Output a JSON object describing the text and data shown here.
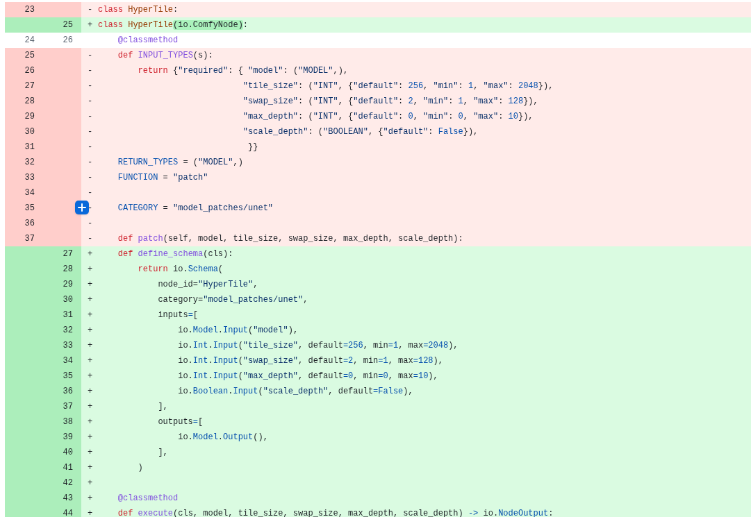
{
  "diff": {
    "rows": [
      {
        "kind": "del",
        "old": "23",
        "sign": "-",
        "code": [
          {
            "kind": "keyword",
            "text": "class"
          },
          {
            "kind": "class",
            "text": " HyperTile"
          },
          {
            "kind": "plain",
            "text": ":"
          }
        ]
      },
      {
        "kind": "add",
        "new": "25",
        "sign": "+",
        "code": [
          {
            "kind": "keyword",
            "text": "class"
          },
          {
            "kind": "class",
            "text": " HyperTile"
          },
          {
            "kind": "plain",
            "text": "(io.ComfyNode)",
            "highlighted": true
          },
          {
            "kind": "plain",
            "text": ":"
          }
        ]
      },
      {
        "kind": "ctx",
        "old": "24",
        "new": "26",
        "code": [
          {
            "kind": "function",
            "text": "    @classmethod"
          }
        ]
      },
      {
        "kind": "del",
        "old": "25",
        "sign": "-",
        "code": [
          {
            "kind": "keyword",
            "text": "    def"
          },
          {
            "kind": "function",
            "text": " INPUT_TYPES"
          },
          {
            "kind": "plain",
            "text": "(s):"
          }
        ]
      },
      {
        "kind": "del",
        "old": "26",
        "sign": "-",
        "code": [
          {
            "kind": "keyword",
            "text": "        return"
          },
          {
            "kind": "plain",
            "text": " {"
          },
          {
            "kind": "string",
            "text": "\"required\""
          },
          {
            "kind": "plain",
            "text": ": { "
          },
          {
            "kind": "string",
            "text": "\"model\""
          },
          {
            "kind": "plain",
            "text": ": ("
          },
          {
            "kind": "string",
            "text": "\"MODEL\""
          },
          {
            "kind": "plain",
            "text": ",),"
          }
        ]
      },
      {
        "kind": "del",
        "old": "27",
        "sign": "-",
        "code": [
          {
            "kind": "string",
            "text": "                             \"tile_size\""
          },
          {
            "kind": "plain",
            "text": ": ("
          },
          {
            "kind": "string",
            "text": "\"INT\""
          },
          {
            "kind": "plain",
            "text": ", {"
          },
          {
            "kind": "string",
            "text": "\"default\""
          },
          {
            "kind": "plain",
            "text": ": "
          },
          {
            "kind": "constant",
            "text": "256"
          },
          {
            "kind": "plain",
            "text": ", "
          },
          {
            "kind": "string",
            "text": "\"min\""
          },
          {
            "kind": "plain",
            "text": ": "
          },
          {
            "kind": "constant",
            "text": "1"
          },
          {
            "kind": "plain",
            "text": ", "
          },
          {
            "kind": "string",
            "text": "\"max\""
          },
          {
            "kind": "plain",
            "text": ": "
          },
          {
            "kind": "constant",
            "text": "2048"
          },
          {
            "kind": "plain",
            "text": "}),"
          }
        ]
      },
      {
        "kind": "del",
        "old": "28",
        "sign": "-",
        "code": [
          {
            "kind": "string",
            "text": "                             \"swap_size\""
          },
          {
            "kind": "plain",
            "text": ": ("
          },
          {
            "kind": "string",
            "text": "\"INT\""
          },
          {
            "kind": "plain",
            "text": ", {"
          },
          {
            "kind": "string",
            "text": "\"default\""
          },
          {
            "kind": "plain",
            "text": ": "
          },
          {
            "kind": "constant",
            "text": "2"
          },
          {
            "kind": "plain",
            "text": ", "
          },
          {
            "kind": "string",
            "text": "\"min\""
          },
          {
            "kind": "plain",
            "text": ": "
          },
          {
            "kind": "constant",
            "text": "1"
          },
          {
            "kind": "plain",
            "text": ", "
          },
          {
            "kind": "string",
            "text": "\"max\""
          },
          {
            "kind": "plain",
            "text": ": "
          },
          {
            "kind": "constant",
            "text": "128"
          },
          {
            "kind": "plain",
            "text": "}),"
          }
        ]
      },
      {
        "kind": "del",
        "old": "29",
        "sign": "-",
        "code": [
          {
            "kind": "string",
            "text": "                             \"max_depth\""
          },
          {
            "kind": "plain",
            "text": ": ("
          },
          {
            "kind": "string",
            "text": "\"INT\""
          },
          {
            "kind": "plain",
            "text": ", {"
          },
          {
            "kind": "string",
            "text": "\"default\""
          },
          {
            "kind": "plain",
            "text": ": "
          },
          {
            "kind": "constant",
            "text": "0"
          },
          {
            "kind": "plain",
            "text": ", "
          },
          {
            "kind": "string",
            "text": "\"min\""
          },
          {
            "kind": "plain",
            "text": ": "
          },
          {
            "kind": "constant",
            "text": "0"
          },
          {
            "kind": "plain",
            "text": ", "
          },
          {
            "kind": "string",
            "text": "\"max\""
          },
          {
            "kind": "plain",
            "text": ": "
          },
          {
            "kind": "constant",
            "text": "10"
          },
          {
            "kind": "plain",
            "text": "}),"
          }
        ]
      },
      {
        "kind": "del",
        "old": "30",
        "sign": "-",
        "code": [
          {
            "kind": "string",
            "text": "                             \"scale_depth\""
          },
          {
            "kind": "plain",
            "text": ": ("
          },
          {
            "kind": "string",
            "text": "\"BOOLEAN\""
          },
          {
            "kind": "plain",
            "text": ", {"
          },
          {
            "kind": "string",
            "text": "\"default\""
          },
          {
            "kind": "plain",
            "text": ": "
          },
          {
            "kind": "constant",
            "text": "False"
          },
          {
            "kind": "plain",
            "text": "}),"
          }
        ]
      },
      {
        "kind": "del",
        "old": "31",
        "sign": "-",
        "code": [
          {
            "kind": "plain",
            "text": "                              }}"
          }
        ]
      },
      {
        "kind": "del",
        "old": "32",
        "sign": "-",
        "code": [
          {
            "kind": "constant",
            "text": "    RETURN_TYPES"
          },
          {
            "kind": "plain",
            "text": " = ("
          },
          {
            "kind": "string",
            "text": "\"MODEL\""
          },
          {
            "kind": "plain",
            "text": ",)"
          }
        ]
      },
      {
        "kind": "del",
        "old": "33",
        "sign": "-",
        "code": [
          {
            "kind": "constant",
            "text": "    FUNCTION"
          },
          {
            "kind": "plain",
            "text": " = "
          },
          {
            "kind": "string",
            "text": "\"patch\""
          }
        ]
      },
      {
        "kind": "del",
        "old": "34",
        "sign": "-"
      },
      {
        "kind": "del",
        "old": "35",
        "sign": "-",
        "code": [
          {
            "kind": "constant",
            "text": "    CATEGORY"
          },
          {
            "kind": "plain",
            "text": " = "
          },
          {
            "kind": "string",
            "text": "\"model_patches/unet\""
          }
        ]
      },
      {
        "kind": "del",
        "old": "36",
        "sign": "-"
      },
      {
        "kind": "del",
        "old": "37",
        "sign": "-",
        "code": [
          {
            "kind": "keyword",
            "text": "    def"
          },
          {
            "kind": "function",
            "text": " patch"
          },
          {
            "kind": "plain",
            "text": "(self, model, tile_size, swap_size, max_depth, scale_depth):"
          }
        ]
      },
      {
        "kind": "add",
        "new": "27",
        "sign": "+",
        "code": [
          {
            "kind": "keyword",
            "text": "    def"
          },
          {
            "kind": "function",
            "text": " define_schema"
          },
          {
            "kind": "plain",
            "text": "(cls):"
          }
        ]
      },
      {
        "kind": "add",
        "new": "28",
        "sign": "+",
        "code": [
          {
            "kind": "keyword",
            "text": "        return"
          },
          {
            "kind": "plain",
            "text": " io."
          },
          {
            "kind": "constant",
            "text": "Schema"
          },
          {
            "kind": "plain",
            "text": "("
          }
        ]
      },
      {
        "kind": "add",
        "new": "29",
        "sign": "+",
        "code": [
          {
            "kind": "plain",
            "text": "            node_id="
          },
          {
            "kind": "string",
            "text": "\"HyperTile\""
          },
          {
            "kind": "plain",
            "text": ","
          }
        ]
      },
      {
        "kind": "add",
        "new": "30",
        "sign": "+",
        "code": [
          {
            "kind": "plain",
            "text": "            category="
          },
          {
            "kind": "string",
            "text": "\"model_patches/unet\""
          },
          {
            "kind": "plain",
            "text": ","
          }
        ]
      },
      {
        "kind": "add",
        "new": "31",
        "sign": "+",
        "code": [
          {
            "kind": "plain",
            "text": "            inputs"
          },
          {
            "kind": "constant",
            "text": "="
          },
          {
            "kind": "plain",
            "text": "["
          }
        ]
      },
      {
        "kind": "add",
        "new": "32",
        "sign": "+",
        "code": [
          {
            "kind": "plain",
            "text": "                io."
          },
          {
            "kind": "constant",
            "text": "Model"
          },
          {
            "kind": "plain",
            "text": "."
          },
          {
            "kind": "constant",
            "text": "Input"
          },
          {
            "kind": "plain",
            "text": "("
          },
          {
            "kind": "string",
            "text": "\"model\""
          },
          {
            "kind": "plain",
            "text": "),"
          }
        ]
      },
      {
        "kind": "add",
        "new": "33",
        "sign": "+",
        "code": [
          {
            "kind": "plain",
            "text": "                io."
          },
          {
            "kind": "constant",
            "text": "Int"
          },
          {
            "kind": "plain",
            "text": "."
          },
          {
            "kind": "constant",
            "text": "Input"
          },
          {
            "kind": "plain",
            "text": "("
          },
          {
            "kind": "string",
            "text": "\"tile_size\""
          },
          {
            "kind": "plain",
            "text": ", default"
          },
          {
            "kind": "constant",
            "text": "=256"
          },
          {
            "kind": "plain",
            "text": ", min"
          },
          {
            "kind": "constant",
            "text": "=1"
          },
          {
            "kind": "plain",
            "text": ", max"
          },
          {
            "kind": "constant",
            "text": "=2048"
          },
          {
            "kind": "plain",
            "text": "),"
          }
        ]
      },
      {
        "kind": "add",
        "new": "34",
        "sign": "+",
        "code": [
          {
            "kind": "plain",
            "text": "                io."
          },
          {
            "kind": "constant",
            "text": "Int"
          },
          {
            "kind": "plain",
            "text": "."
          },
          {
            "kind": "constant",
            "text": "Input"
          },
          {
            "kind": "plain",
            "text": "("
          },
          {
            "kind": "string",
            "text": "\"swap_size\""
          },
          {
            "kind": "plain",
            "text": ", default"
          },
          {
            "kind": "constant",
            "text": "=2"
          },
          {
            "kind": "plain",
            "text": ", min"
          },
          {
            "kind": "constant",
            "text": "=1"
          },
          {
            "kind": "plain",
            "text": ", max"
          },
          {
            "kind": "constant",
            "text": "=128"
          },
          {
            "kind": "plain",
            "text": "),"
          }
        ]
      },
      {
        "kind": "add",
        "new": "35",
        "sign": "+",
        "code": [
          {
            "kind": "plain",
            "text": "                io."
          },
          {
            "kind": "constant",
            "text": "Int"
          },
          {
            "kind": "plain",
            "text": "."
          },
          {
            "kind": "constant",
            "text": "Input"
          },
          {
            "kind": "plain",
            "text": "("
          },
          {
            "kind": "string",
            "text": "\"max_depth\""
          },
          {
            "kind": "plain",
            "text": ", default"
          },
          {
            "kind": "constant",
            "text": "=0"
          },
          {
            "kind": "plain",
            "text": ", min"
          },
          {
            "kind": "constant",
            "text": "=0"
          },
          {
            "kind": "plain",
            "text": ", max"
          },
          {
            "kind": "constant",
            "text": "=10"
          },
          {
            "kind": "plain",
            "text": "),"
          }
        ]
      },
      {
        "kind": "add",
        "new": "36",
        "sign": "+",
        "code": [
          {
            "kind": "plain",
            "text": "                io."
          },
          {
            "kind": "constant",
            "text": "Boolean"
          },
          {
            "kind": "plain",
            "text": "."
          },
          {
            "kind": "constant",
            "text": "Input"
          },
          {
            "kind": "plain",
            "text": "("
          },
          {
            "kind": "string",
            "text": "\"scale_depth\""
          },
          {
            "kind": "plain",
            "text": ", default"
          },
          {
            "kind": "constant",
            "text": "=False"
          },
          {
            "kind": "plain",
            "text": "),"
          }
        ]
      },
      {
        "kind": "add",
        "new": "37",
        "sign": "+",
        "code": [
          {
            "kind": "plain",
            "text": "            ],"
          }
        ]
      },
      {
        "kind": "add",
        "new": "38",
        "sign": "+",
        "code": [
          {
            "kind": "plain",
            "text": "            outputs"
          },
          {
            "kind": "constant",
            "text": "="
          },
          {
            "kind": "plain",
            "text": "["
          }
        ]
      },
      {
        "kind": "add",
        "new": "39",
        "sign": "+",
        "code": [
          {
            "kind": "plain",
            "text": "                io."
          },
          {
            "kind": "constant",
            "text": "Model"
          },
          {
            "kind": "plain",
            "text": "."
          },
          {
            "kind": "constant",
            "text": "Output"
          },
          {
            "kind": "plain",
            "text": "(),"
          }
        ]
      },
      {
        "kind": "add",
        "new": "40",
        "sign": "+",
        "code": [
          {
            "kind": "plain",
            "text": "            ],"
          }
        ]
      },
      {
        "kind": "add",
        "new": "41",
        "sign": "+",
        "code": [
          {
            "kind": "plain",
            "text": "        )"
          }
        ]
      },
      {
        "kind": "add",
        "new": "42",
        "sign": "+"
      },
      {
        "kind": "add",
        "new": "43",
        "sign": "+",
        "code": [
          {
            "kind": "function",
            "text": "    @classmethod"
          }
        ]
      },
      {
        "kind": "add",
        "new": "44",
        "sign": "+",
        "code": [
          {
            "kind": "keyword",
            "text": "    def"
          },
          {
            "kind": "function",
            "text": " execute"
          },
          {
            "kind": "plain",
            "text": "(cls, model, tile_size, swap_size, max_depth, scale_depth) "
          },
          {
            "kind": "constant",
            "text": "->"
          },
          {
            "kind": "plain",
            "text": " io."
          },
          {
            "kind": "constant",
            "text": "NodeOutput"
          },
          {
            "kind": "plain",
            "text": ":"
          }
        ]
      }
    ]
  }
}
